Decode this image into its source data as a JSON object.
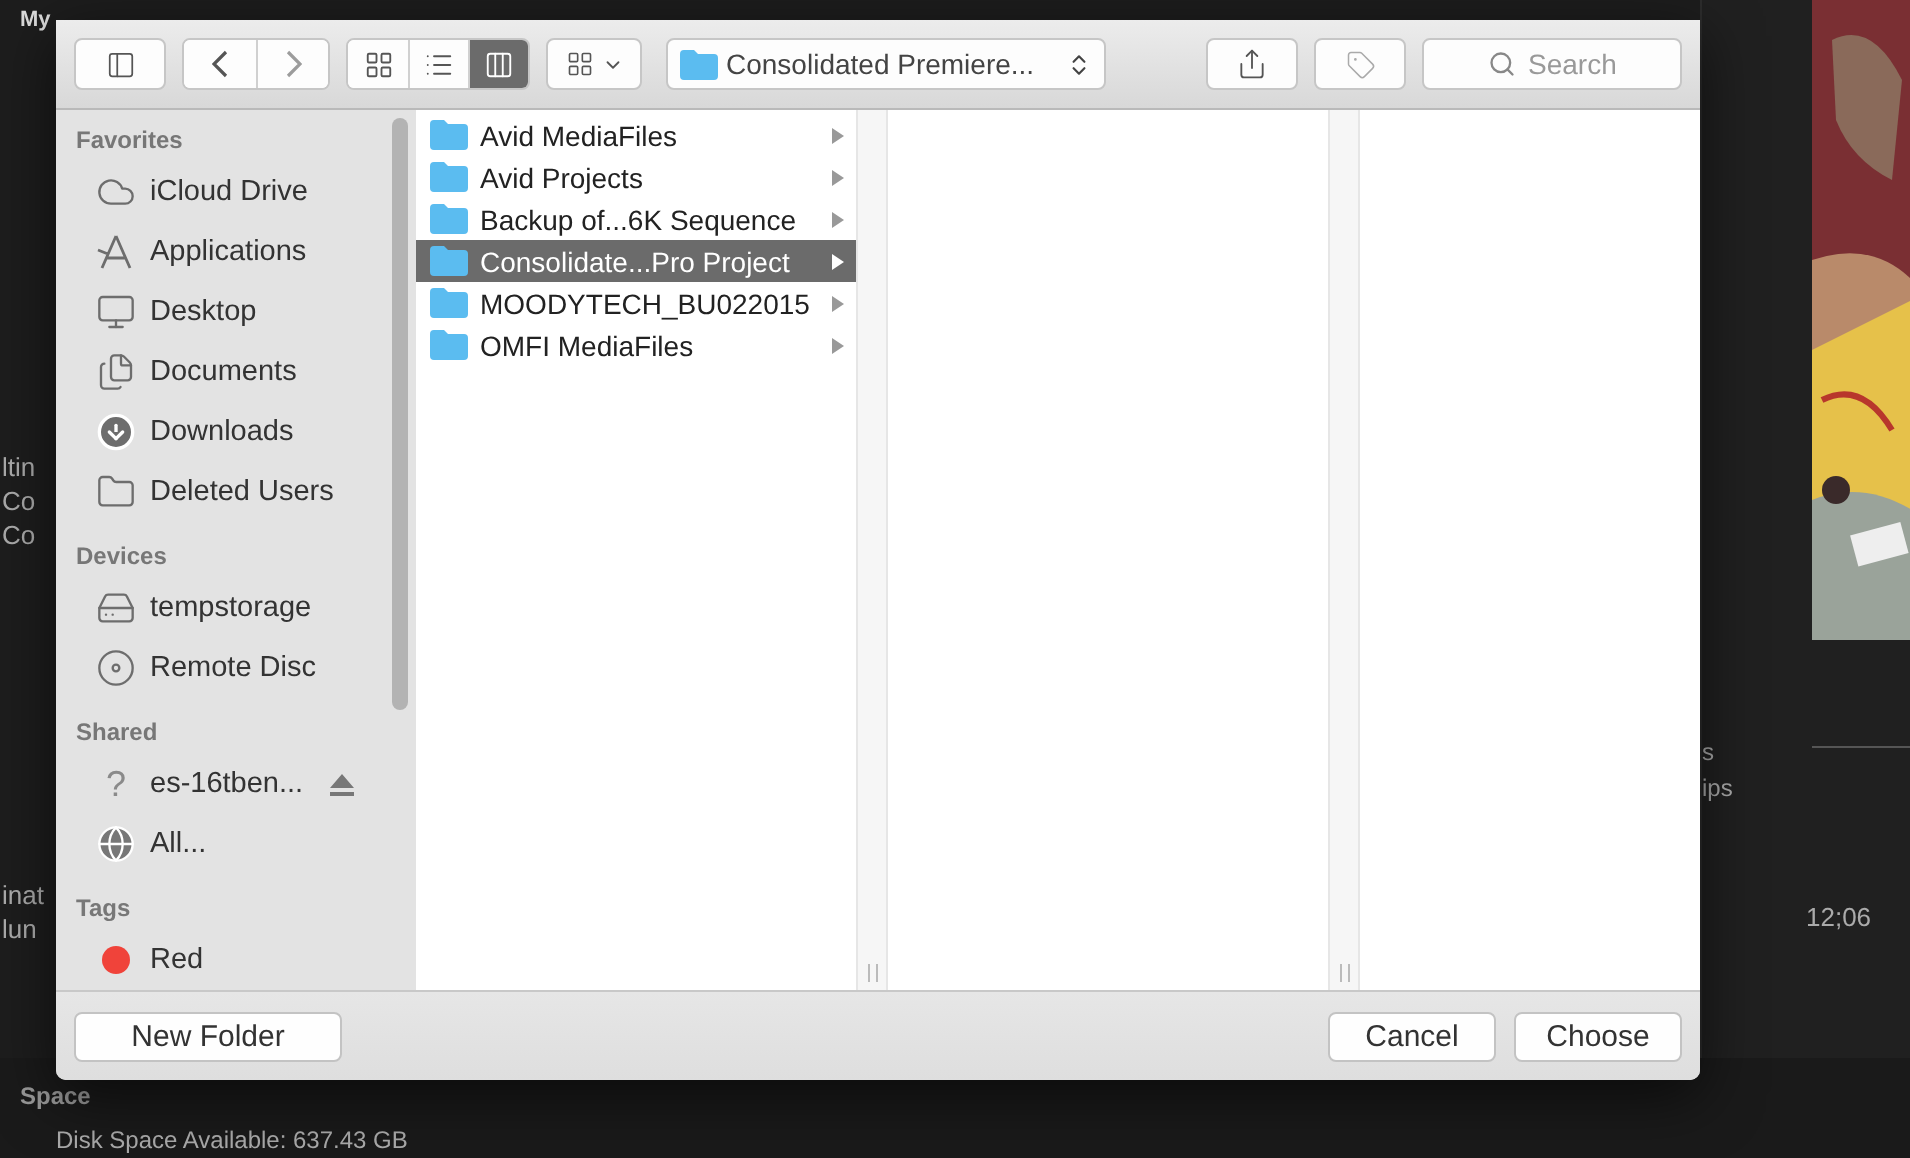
{
  "background": {
    "title": "My",
    "left_fragments_upper": [
      "ltin",
      "Co",
      "Co"
    ],
    "left_fragments_lower": [
      "inat",
      "lun"
    ],
    "section": "Space",
    "disk_space": "Disk Space Available: 637.43 GB",
    "right_fragments": [
      "s",
      "ips"
    ],
    "timecode": "12;06"
  },
  "dialog": {
    "toolbar": {
      "back_disabled": false,
      "forward_disabled": true,
      "view_modes": [
        {
          "kind": "icon",
          "selected": false
        },
        {
          "kind": "list",
          "selected": false
        },
        {
          "kind": "column",
          "selected": true
        }
      ],
      "path": "Consolidated Premiere...",
      "search": {
        "placeholder": "Search"
      }
    },
    "sidebar": [
      {
        "heading": "Favorites",
        "items": [
          {
            "label": "iCloud Drive",
            "kind": "cloud"
          },
          {
            "label": "Applications",
            "kind": "apps"
          },
          {
            "label": "Desktop",
            "kind": "desktop"
          },
          {
            "label": "Documents",
            "kind": "documents"
          },
          {
            "label": "Downloads",
            "kind": "downloads"
          },
          {
            "label": "Deleted Users",
            "kind": "folder"
          }
        ]
      },
      {
        "heading": "Devices",
        "items": [
          {
            "label": "tempstorage",
            "kind": "disk"
          },
          {
            "label": "Remote Disc",
            "kind": "disc"
          }
        ]
      },
      {
        "heading": "Shared",
        "items": [
          {
            "label": "es-16tben...",
            "kind": "glyph",
            "glyph": "?",
            "ejectable": true
          },
          {
            "label": "All...",
            "kind": "network"
          }
        ]
      },
      {
        "heading": "Tags",
        "items": [
          {
            "label": "Red",
            "kind": "tag",
            "color": "#f0433a"
          }
        ]
      }
    ],
    "columns": [
      {
        "items": [
          {
            "name": "Avid MediaFiles",
            "selected": false
          },
          {
            "name": "Avid Projects",
            "selected": false
          },
          {
            "name": "Backup of...6K Sequence",
            "selected": false
          },
          {
            "name": "Consolidate...Pro Project",
            "selected": true
          },
          {
            "name": "MOODYTECH_BU022015",
            "selected": false
          },
          {
            "name": "OMFI MediaFiles",
            "selected": false
          }
        ]
      }
    ],
    "buttons": {
      "new_folder": "New Folder",
      "cancel": "Cancel",
      "choose": "Choose"
    }
  }
}
